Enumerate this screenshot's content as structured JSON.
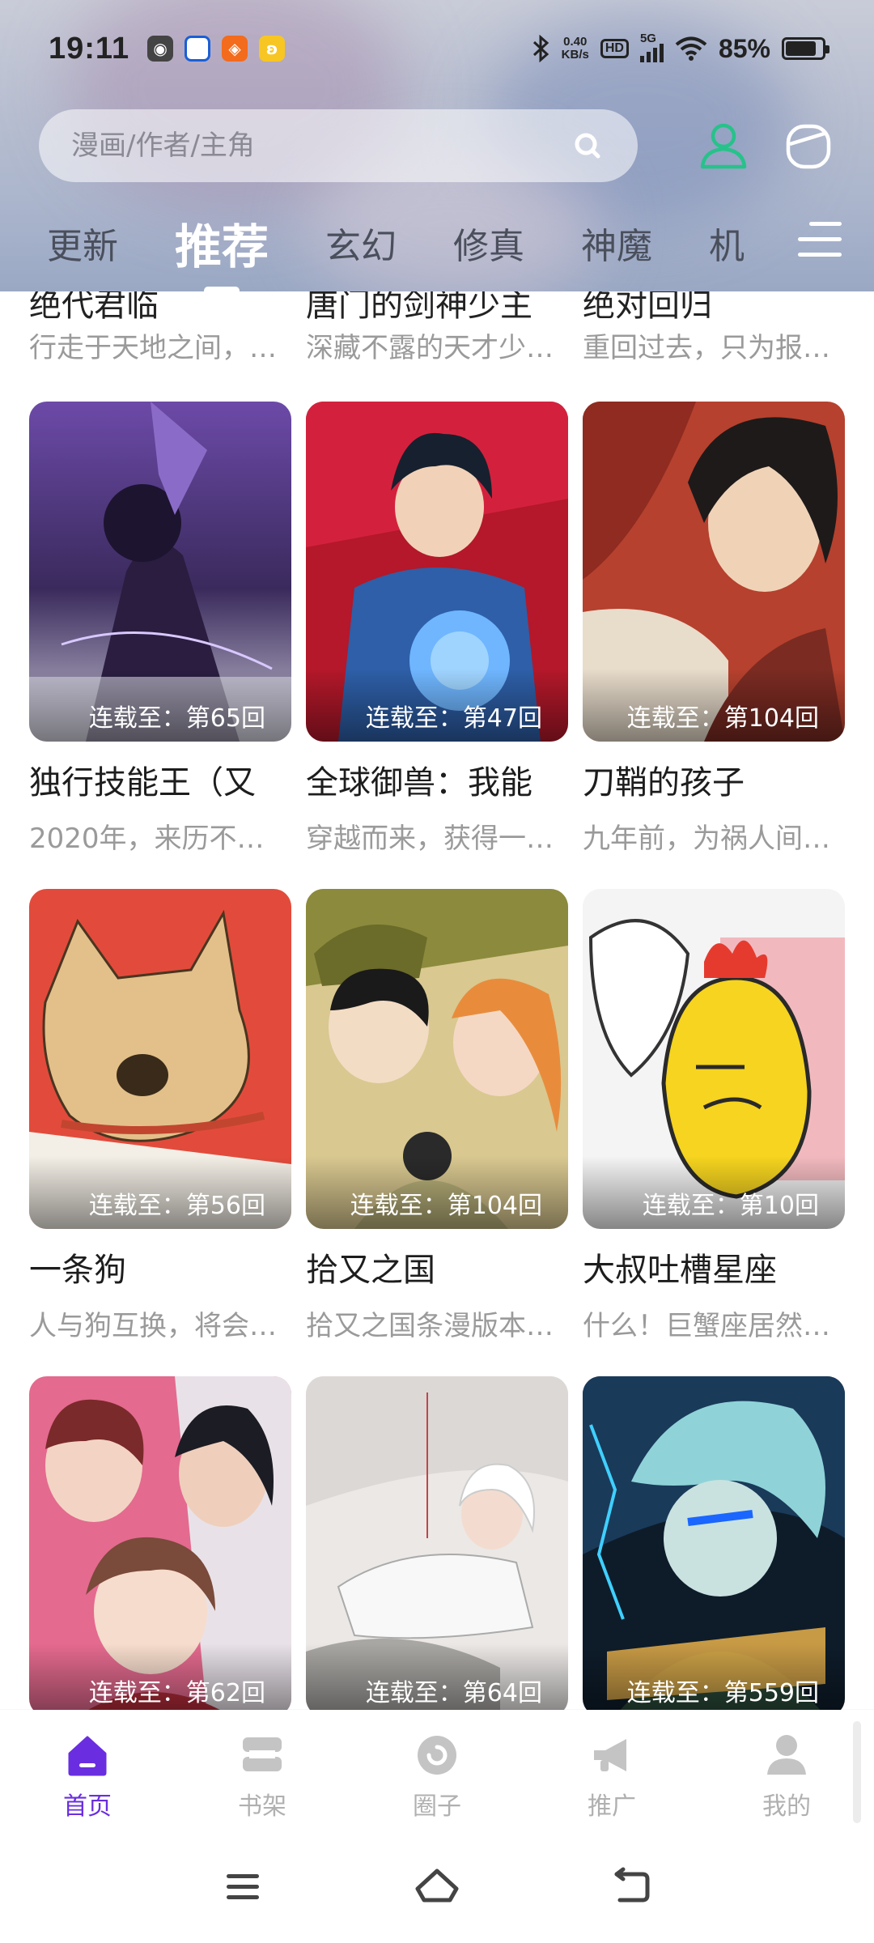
{
  "status_bar": {
    "time": "19:11",
    "net_speed_value": "0.40",
    "net_speed_unit": "KB/s",
    "hd": "HD",
    "signal": "5G",
    "battery_text": "85%",
    "battery_level": 0.85
  },
  "search": {
    "placeholder": "漫画/作者/主角"
  },
  "tabs": [
    {
      "label": "更新"
    },
    {
      "label": "推荐",
      "active": true
    },
    {
      "label": "玄幻"
    },
    {
      "label": "修真"
    },
    {
      "label": "神魔"
    },
    {
      "label": "机"
    }
  ],
  "partial_row": [
    {
      "title": "绝代君临",
      "desc": "行走于天地之间，…"
    },
    {
      "title": "唐门的剑神少主",
      "desc": "深藏不露的天才少…"
    },
    {
      "title": "绝对回归",
      "desc": "重回过去，只为报…"
    }
  ],
  "comics": [
    {
      "title": "独行技能王（又",
      "desc": "2020年，来历不…",
      "progress": "连载至：第65回"
    },
    {
      "title": "全球御兽：我能",
      "desc": "穿越而来，获得一…",
      "progress": "连载至：第47回"
    },
    {
      "title": "刀鞘的孩子",
      "desc": "九年前，为祸人间…",
      "progress": "连载至：第104回"
    },
    {
      "title": "一条狗",
      "desc": "人与狗互换，将会…",
      "progress": "连载至：第56回"
    },
    {
      "title": "拾又之国",
      "desc": "拾又之国条漫版本…",
      "progress": "连载至：第104回"
    },
    {
      "title": "大叔吐槽星座",
      "desc": "什么！巨蟹座居然…",
      "progress": "连载至：第10回"
    },
    {
      "title": "",
      "desc": "",
      "progress": "连载至：第62回"
    },
    {
      "title": "",
      "desc": "",
      "progress": "连载至：第64回"
    },
    {
      "title": "",
      "desc": "",
      "progress": "连载至：第559回"
    }
  ],
  "bottom_nav": [
    {
      "label": "首页",
      "active": true
    },
    {
      "label": "书架"
    },
    {
      "label": "圈子"
    },
    {
      "label": "推广"
    },
    {
      "label": "我的"
    }
  ],
  "colors": {
    "accent": "#6a2ee0",
    "user_icon": "#27c28a",
    "inactive_nav": "#b0b0b0"
  }
}
